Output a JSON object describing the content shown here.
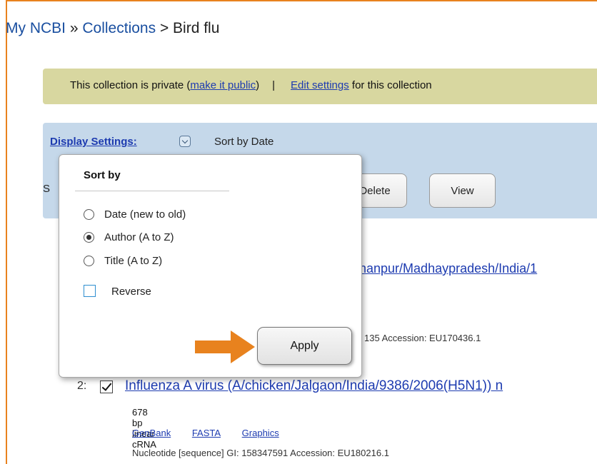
{
  "breadcrumb": {
    "root": "My NCBI",
    "separator": "»",
    "collections": "Collections",
    "sep2": ">",
    "current": "Bird flu"
  },
  "notice": {
    "text_before": "This collection is private (",
    "make_public": "make it public",
    "text_after_link": ")",
    "separator": "|",
    "edit_settings": "Edit settings",
    "text_end": " for this collection"
  },
  "display_settings": {
    "label": "Display Settings:",
    "current_sort": "Sort by Date",
    "s_letter": "S"
  },
  "toolbar": {
    "delete_label": "Delete",
    "view_label": "View"
  },
  "popup": {
    "title": "Sort by",
    "options": [
      {
        "label": "Date (new to old)",
        "selected": false
      },
      {
        "label": "Author (A to Z)",
        "selected": true
      },
      {
        "label": "Title (A to Z)",
        "selected": false
      }
    ],
    "reverse_label": "Reverse",
    "apply_label": "Apply"
  },
  "results": [
    {
      "link_visible": "hanpur/Madhaypradesh/India/1",
      "meta_visible": "135   Accession: EU170436.1"
    },
    {
      "number": "2:",
      "title": "Influenza A virus (A/chicken/Jalgaon/India/9386/2006(H5N1)) n",
      "desc": "678 bp linear cRNA",
      "links": [
        "GenBank",
        "FASTA",
        "Graphics"
      ],
      "meta": "Nucleotide [sequence]    GI: 158347591   Accession: EU180216.1"
    }
  ],
  "colors": {
    "accent_arrow": "#e8821e",
    "notice_bg": "#d8d7a0",
    "settings_bg": "#c5d8ea",
    "link": "#1d3bb0"
  }
}
